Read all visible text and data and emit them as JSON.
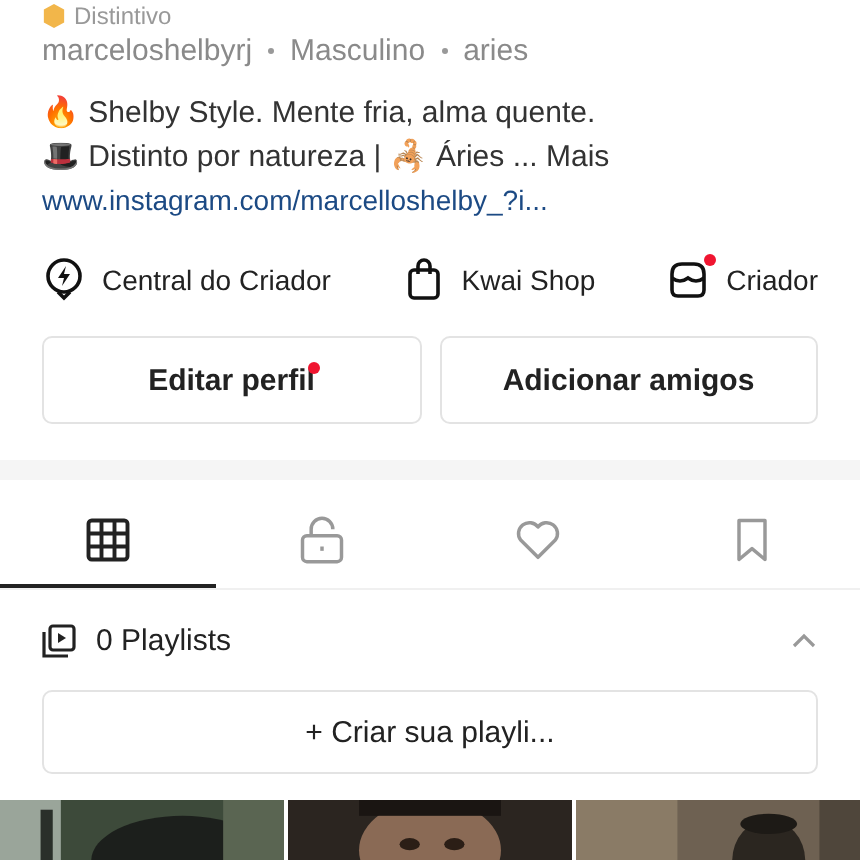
{
  "badge_line": {
    "text": "Distintivo"
  },
  "meta": [
    "marceloshelbyrj",
    "Masculino",
    "aries"
  ],
  "bio": {
    "lines": [
      "🔥 Shelby Style. Mente fria, alma quente.",
      "🎩 Distinto por natureza | 🦂 Áries ..."
    ],
    "more": "Mais",
    "link": "www.instagram.com/marcelloshelby_?i..."
  },
  "shortcuts": [
    {
      "kind": "bolt",
      "label": "Central do Criador",
      "dot": false
    },
    {
      "kind": "bag",
      "label": "Kwai Shop",
      "dot": false
    },
    {
      "kind": "store",
      "label": "Criador",
      "dot": true
    }
  ],
  "buttons": [
    {
      "label": "Editar perfil",
      "dot": true
    },
    {
      "label": "Adicionar amigos",
      "dot": false
    }
  ],
  "tabs": [
    {
      "kind": "grid",
      "selected": true
    },
    {
      "kind": "lock",
      "selected": false
    },
    {
      "kind": "heart",
      "selected": false
    },
    {
      "kind": "bookmark",
      "selected": false
    }
  ],
  "playlists": {
    "title": "0 Playlists",
    "expanded": true,
    "create_button": "+ Criar sua playli..."
  },
  "thumbnails": [
    {
      "kind": "picture"
    },
    {
      "kind": "picture"
    },
    {
      "kind": "picture"
    }
  ]
}
